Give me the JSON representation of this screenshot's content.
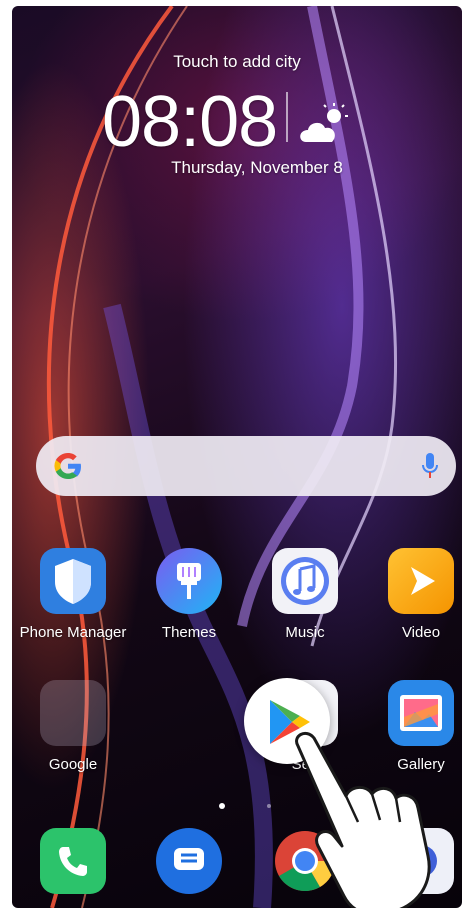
{
  "weather_widget": {
    "city_prompt": "Touch to add city",
    "time": "08:08",
    "date": "Thursday, November 8",
    "weather_icon": "partly-sunny-icon"
  },
  "search_bar": {
    "logo_icon": "google-g-icon",
    "mic_icon": "microphone-icon"
  },
  "apps": [
    {
      "label": "Phone Manager",
      "icon": "shield-icon"
    },
    {
      "label": "Themes",
      "icon": "paint-brush-icon"
    },
    {
      "label": "Music",
      "icon": "music-note-icon"
    },
    {
      "label": "Video",
      "icon": "play-icon"
    },
    {
      "label": "Google",
      "icon": "folder-icon"
    },
    {
      "label": "Settings",
      "icon": "gear-icon"
    },
    {
      "label": "Gallery",
      "icon": "gallery-icon"
    }
  ],
  "settings_visible_label": "Sett",
  "page_indicator": {
    "pages": 2,
    "current": 1
  },
  "dock": [
    {
      "icon": "phone-icon"
    },
    {
      "icon": "messages-icon"
    },
    {
      "icon": "chrome-icon"
    },
    {
      "icon": "camera-icon"
    }
  ],
  "overlay": {
    "dragged_icon": "play-store-icon",
    "gesture": "hand-pointer-icon"
  },
  "colors": {
    "phone_manager": "#2f7fe0",
    "themes": "#3a7fe8",
    "music": "#4a7fe8",
    "video": "#f6a100",
    "gallery": "#2a88e8",
    "dock_phone": "#2cc36b",
    "dock_messages": "#1f6fe0"
  }
}
